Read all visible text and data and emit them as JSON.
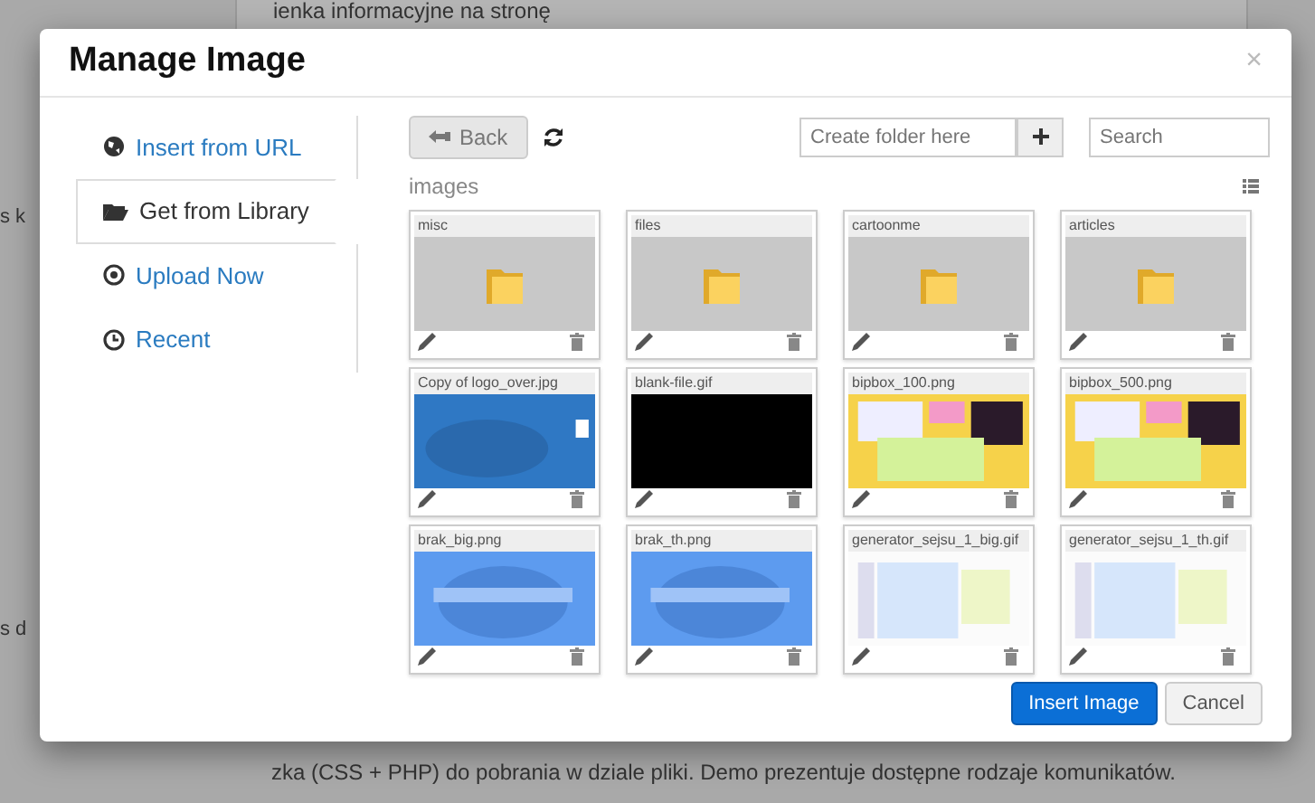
{
  "background": {
    "top_text": "ienka informacyjne na stronę",
    "left_texts": [
      "s k",
      "s d"
    ],
    "bottom_text": "zka (CSS + PHP) do pobrania w dziale pliki. Demo prezentuje dostępne rodzaje komunikatów."
  },
  "dialog": {
    "title": "Manage Image",
    "close": "×"
  },
  "sidebar": {
    "items": [
      {
        "label": "Insert from URL",
        "selected": false
      },
      {
        "label": "Get from Library",
        "selected": true
      },
      {
        "label": "Upload Now",
        "selected": false
      },
      {
        "label": "Recent",
        "selected": false
      }
    ]
  },
  "toolbar": {
    "back": "Back",
    "new_folder": {
      "placeholder": "Create folder here"
    },
    "search": {
      "placeholder": "Search"
    }
  },
  "path": "images",
  "files": [
    {
      "name": "misc",
      "kind": "folder"
    },
    {
      "name": "files",
      "kind": "folder"
    },
    {
      "name": "cartoonme",
      "kind": "folder"
    },
    {
      "name": "articles",
      "kind": "folder"
    },
    {
      "name": "Copy of logo_over.jpg",
      "kind": "picture"
    },
    {
      "name": "blank-file.gif",
      "kind": "picture"
    },
    {
      "name": "bipbox_100.png",
      "kind": "picture"
    },
    {
      "name": "bipbox_500.png",
      "kind": "picture"
    },
    {
      "name": "brak_big.png",
      "kind": "picture"
    },
    {
      "name": "brak_th.png",
      "kind": "picture"
    },
    {
      "name": "generator_sejsu_1_big.gif",
      "kind": "picture"
    },
    {
      "name": "generator_sejsu_1_th.gif",
      "kind": "picture"
    }
  ],
  "buttons": {
    "insert": "Insert Image",
    "cancel": "Cancel"
  }
}
